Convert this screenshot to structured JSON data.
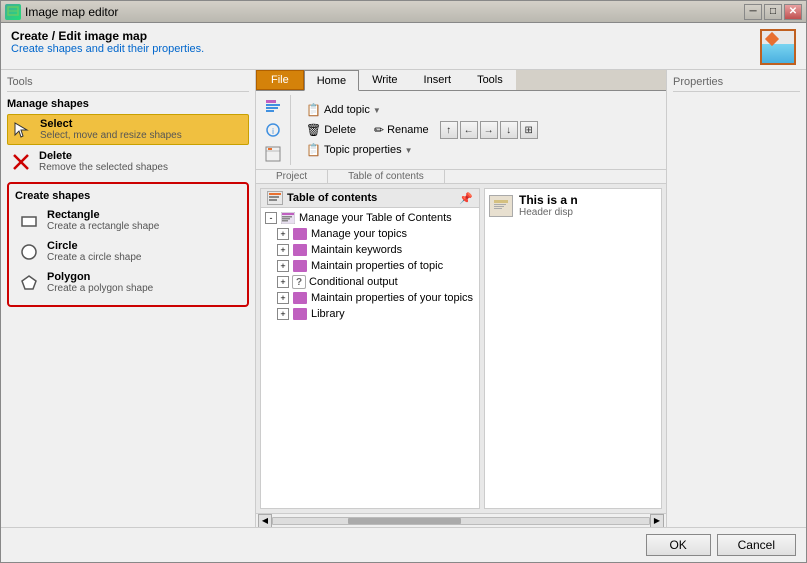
{
  "window": {
    "title": "Image map editor",
    "title_icon": "🗺"
  },
  "header": {
    "title": "Create / Edit image map",
    "subtitle": "Create shapes and edit their properties."
  },
  "tools_panel": {
    "section_title": "Tools",
    "manage_shapes_header": "Manage shapes",
    "select_tool": {
      "name": "Select",
      "description": "Select, move and resize shapes"
    },
    "delete_tool": {
      "name": "Delete",
      "description": "Remove the selected shapes"
    },
    "create_shapes_header": "Create shapes",
    "rectangle_tool": {
      "name": "Rectangle",
      "description": "Create a rectangle shape"
    },
    "circle_tool": {
      "name": "Circle",
      "description": "Create a circle shape"
    },
    "polygon_tool": {
      "name": "Polygon",
      "description": "Create a polygon shape"
    }
  },
  "ribbon": {
    "tabs": [
      "File",
      "Home",
      "Write",
      "Insert",
      "Tools"
    ],
    "active_tab": "Home",
    "file_tab": "File",
    "add_topic_btn": "Add topic",
    "delete_btn": "Delete",
    "rename_btn": "Rename",
    "topic_properties_btn": "Topic properties",
    "groups": [
      "Project",
      "Table of contents"
    ]
  },
  "toc": {
    "header": "Table of contents",
    "root_item": "Manage your Table of Contents",
    "items": [
      "Manage your topics",
      "Maintain keywords",
      "Maintain properties of topic",
      "Conditional output",
      "Maintain properties of your topics",
      "Library"
    ]
  },
  "preview": {
    "title": "This is a n",
    "description": "Header disp"
  },
  "properties_panel": {
    "title": "Properties"
  },
  "bottom_bar": {
    "ok_label": "OK",
    "cancel_label": "Cancel"
  }
}
